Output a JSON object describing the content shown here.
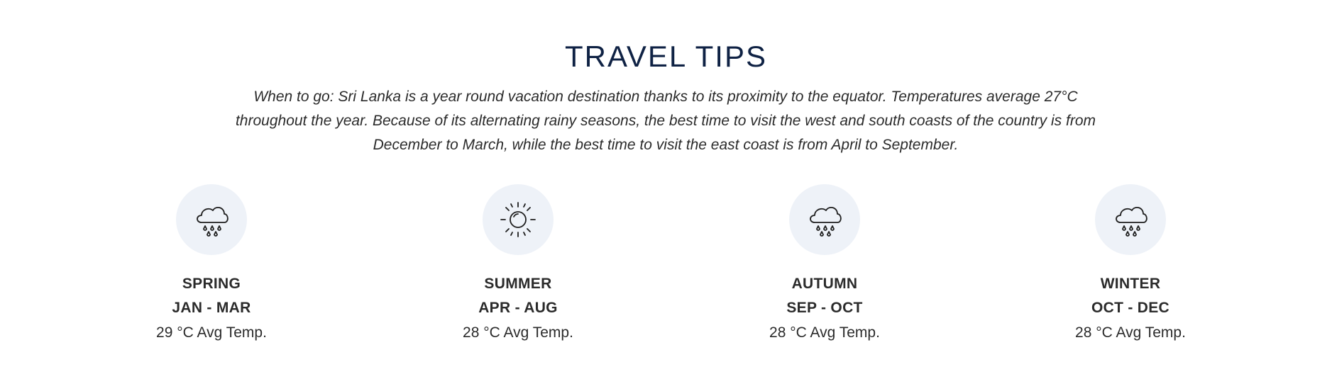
{
  "title": "TRAVEL TIPS",
  "intro": "When to go: Sri Lanka is a year round vacation destination thanks to its proximity to the equator. Temperatures average 27°C throughout the year. Because of its alternating rainy seasons, the best time to visit the west and south coasts of the country is from December to March, while the best time to visit the east coast is from April to September.",
  "seasons": [
    {
      "name": "SPRING",
      "months": "JAN - MAR",
      "temp": "29 °C Avg Temp.",
      "icon": "rain-cloud-icon"
    },
    {
      "name": "SUMMER",
      "months": "APR - AUG",
      "temp": "28 °C Avg Temp.",
      "icon": "sun-icon"
    },
    {
      "name": "AUTUMN",
      "months": "SEP - OCT",
      "temp": "28 °C Avg Temp.",
      "icon": "rain-cloud-icon"
    },
    {
      "name": "WINTER",
      "months": "OCT - DEC",
      "temp": "28 °C Avg Temp.",
      "icon": "rain-cloud-icon"
    }
  ],
  "colors": {
    "title": "#0f2244",
    "text": "#2b2b2b",
    "icon_bg": "#eef2f8"
  }
}
